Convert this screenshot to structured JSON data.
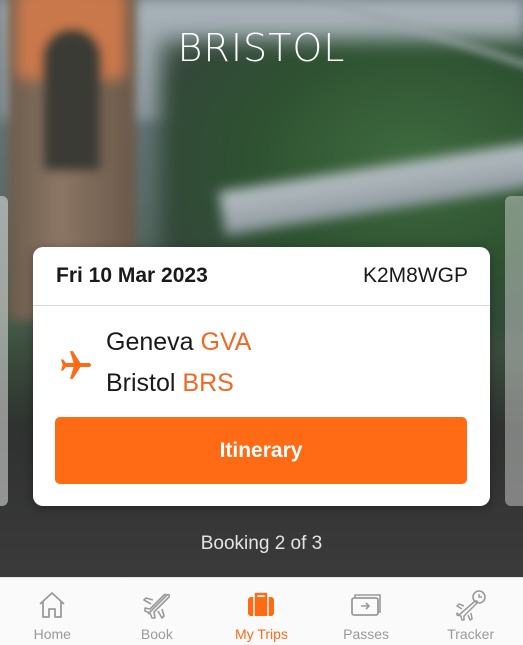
{
  "hero": {
    "city": "BRISTOL"
  },
  "booking": {
    "date": "Fri 10 Mar 2023",
    "reference": "K2M8WGP",
    "origin_city": "Geneva",
    "origin_code": "GVA",
    "destination_city": "Bristol",
    "destination_code": "BRS",
    "itinerary_label": "Itinerary"
  },
  "carousel": {
    "position_text": "Booking 2 of 3"
  },
  "tabbar": {
    "items": [
      {
        "label": "Home",
        "icon": "home-icon",
        "active": false
      },
      {
        "label": "Book",
        "icon": "plane-icon",
        "active": false
      },
      {
        "label": "My Trips",
        "icon": "suitcase-icon",
        "active": true
      },
      {
        "label": "Passes",
        "icon": "boarding-pass-icon",
        "active": false
      },
      {
        "label": "Tracker",
        "icon": "flight-tracker-icon",
        "active": false
      }
    ]
  },
  "colors": {
    "accent": "#ff6a14",
    "inactive": "#9a9a9a"
  }
}
